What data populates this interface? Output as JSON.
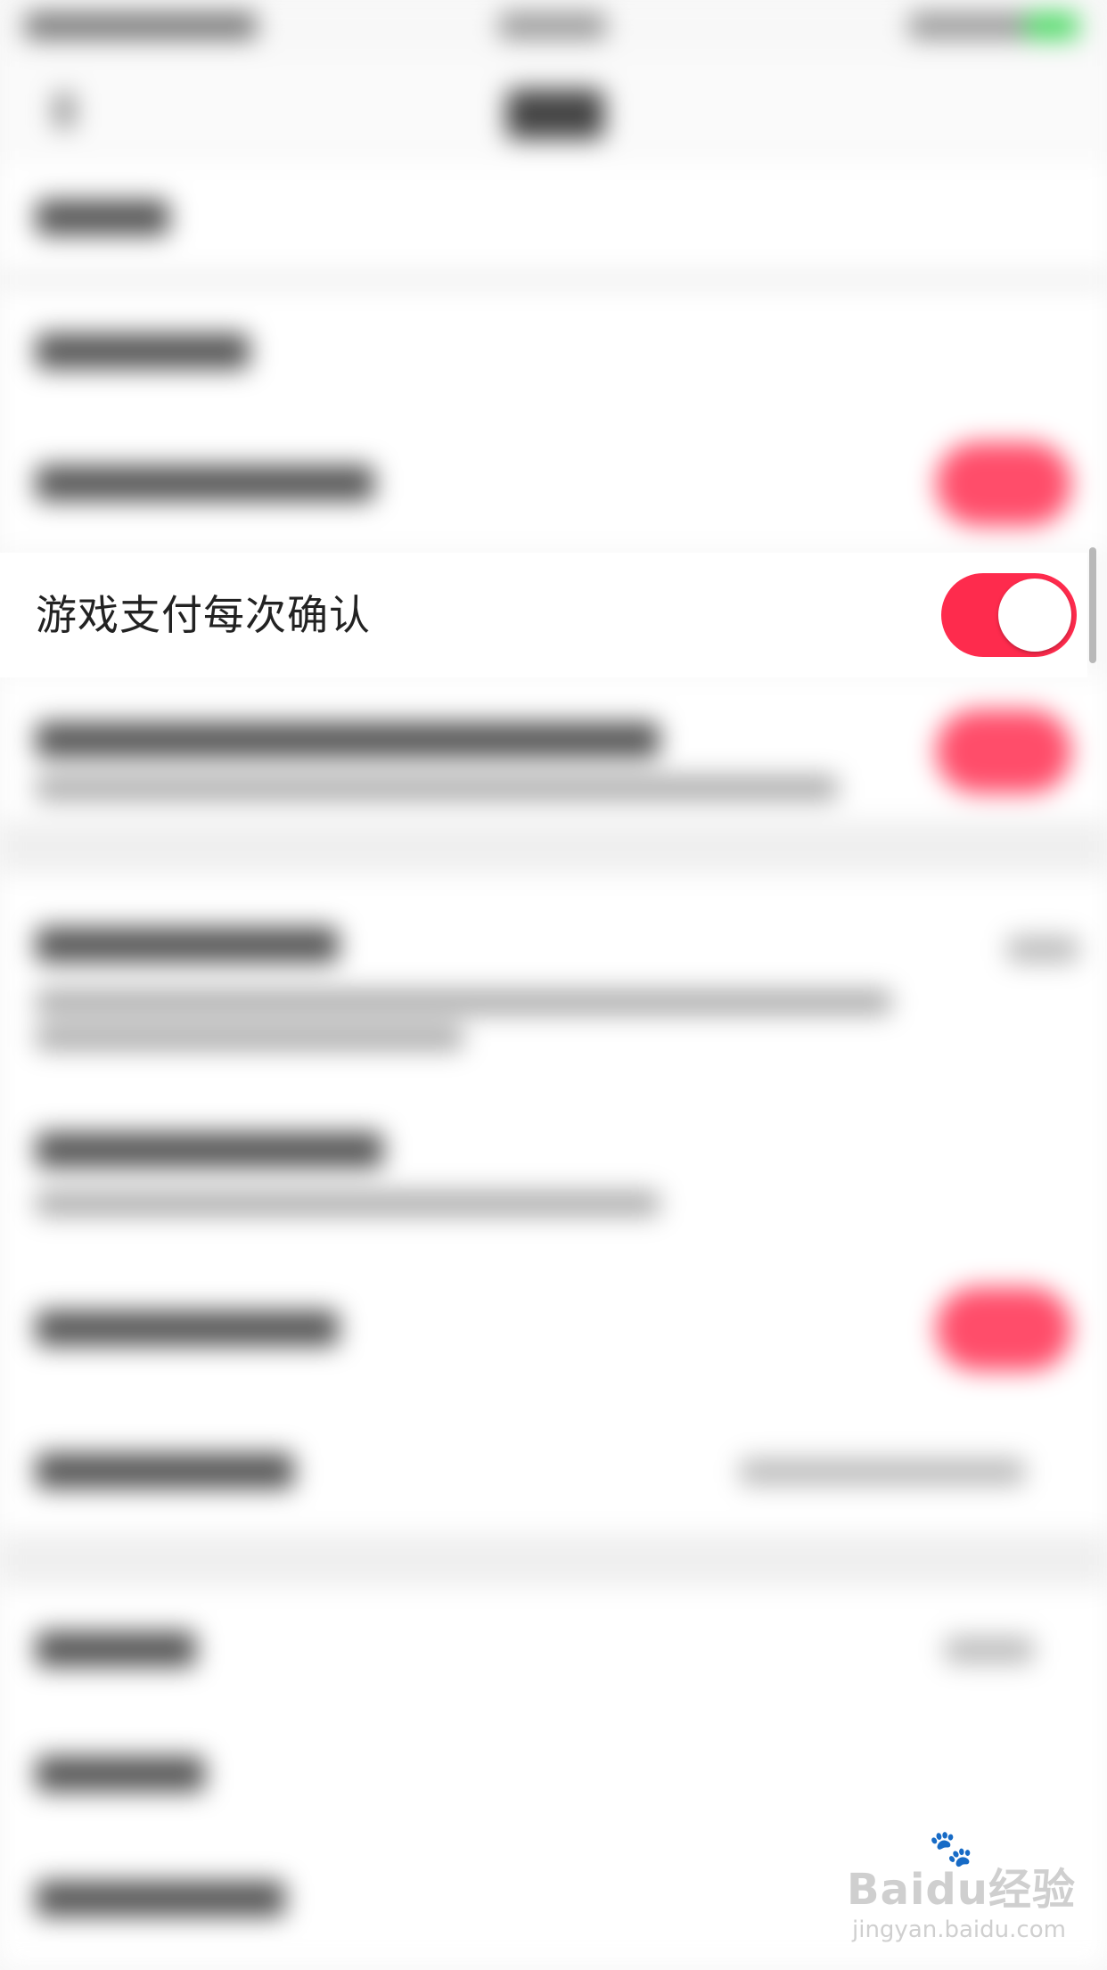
{
  "focused_setting": {
    "label": "游戏支付每次确认",
    "toggle_state": "on",
    "toggle_color": "#fe2b4d"
  },
  "watermark": {
    "logo_text": "Baidu经验",
    "url": "jingyan.baidu.com"
  },
  "colors": {
    "accent": "#fe2b4d",
    "background": "#f7f7f7"
  }
}
